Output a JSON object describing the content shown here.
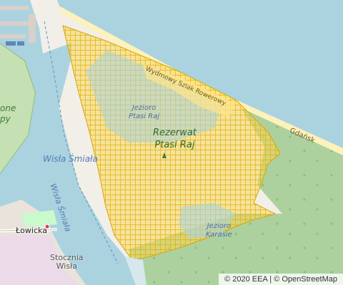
{
  "map": {
    "colors": {
      "sea": "#aad3df",
      "water": "#aad3df",
      "land": "#f2efe9",
      "forest": "#add19e",
      "park": "#c8facc",
      "beach": "#fff1ba",
      "industrial": "#ebdbe8",
      "overlay": "#f2c91e",
      "overlay_stroke": "#e0a600"
    },
    "labels": {
      "river": "Wisła Śmiała",
      "river_channel": "Wisła Śmiała",
      "partial_left": "one",
      "partial_left_2": "py",
      "place_lowicka": "Łowicka",
      "district": "Stocznia\nWisła",
      "gdansk_road": "Gdańsk",
      "road_along_beach": "Wydmowy Szlak Rowerowy",
      "reserve_name": "Rezerwat\nPtasi Raj",
      "lake_north": "Jezioro\nPtasi Raj",
      "lake_south": "Jezioro\nKarasie"
    },
    "icons": [
      "forest-tree-icon",
      "reserve-marker-icon",
      "place-dot-icon"
    ],
    "attribution": "© 2020 EEA | © OpenStreetMap"
  }
}
